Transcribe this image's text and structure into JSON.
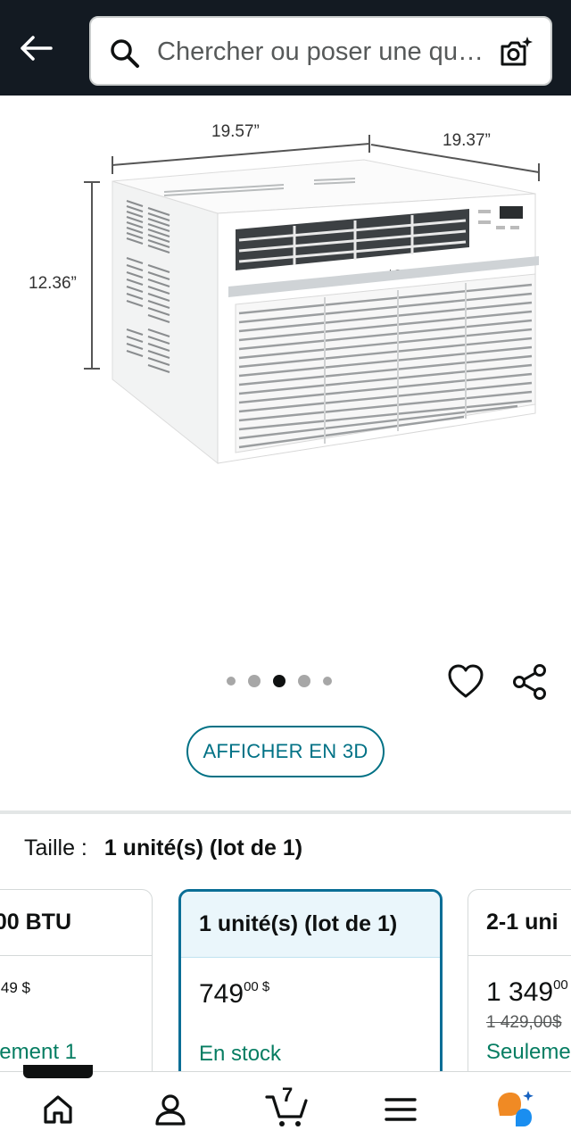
{
  "header": {
    "search_placeholder": "Chercher ou poser une qu…"
  },
  "product_image": {
    "dim_width": "19.57”",
    "dim_depth": "19.37”",
    "dim_height": "12.36”",
    "brand_mark": "LG",
    "display_reading": "60"
  },
  "carousel": {
    "dots": 5,
    "active_index": 2
  },
  "buttons": {
    "view_3d": "AFFICHER EN 3D"
  },
  "size": {
    "label": "Taille :",
    "value": "1 unité(s) (lot de 1)"
  },
  "options": [
    {
      "title": "00 BTU",
      "price": "49 $",
      "stock": "ement 1",
      "strike": ""
    },
    {
      "title": "1 unité(s) (lot de 1)",
      "price_main": "749",
      "price_sup": "00 $",
      "stock": "En stock",
      "selected": true
    },
    {
      "title": "2-1 uni",
      "price_main": "1 349",
      "price_sup": "00",
      "strike": "1 429,00$",
      "stock": "Seuleme"
    }
  ],
  "tabbar": {
    "cart_count": "7"
  },
  "colors": {
    "header_bg": "#131a22",
    "accent_teal": "#007185",
    "stock_green": "#067d62",
    "selected_border": "#0a6e96"
  }
}
